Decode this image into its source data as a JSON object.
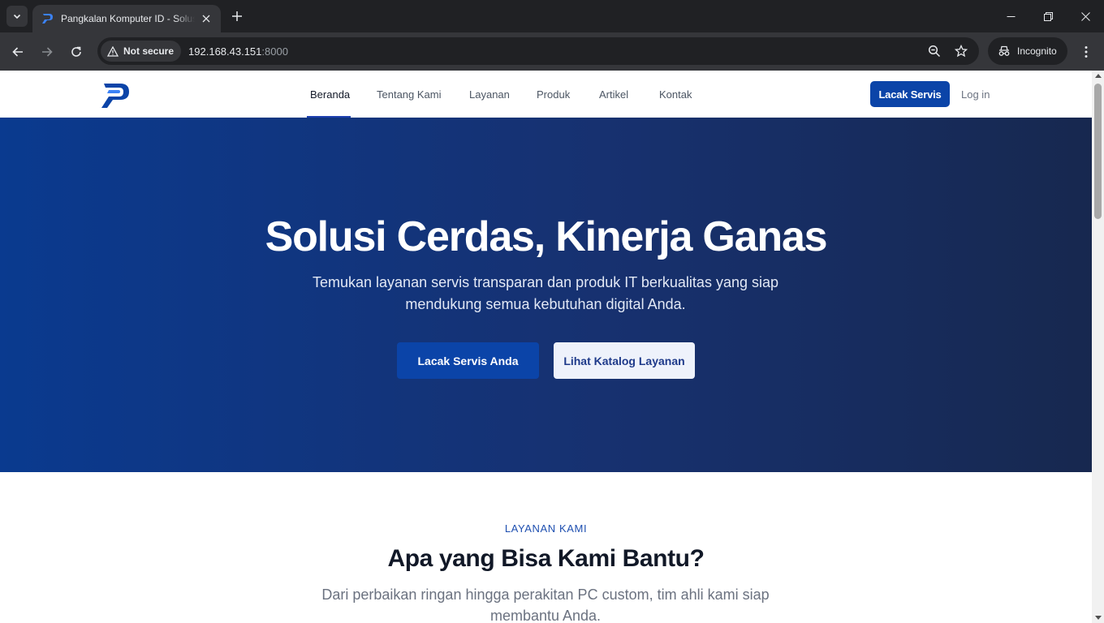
{
  "browser": {
    "tab_title": "Pangkalan Komputer ID - Solusi",
    "security_label": "Not secure",
    "url_host": "192.168.43.151",
    "url_port": ":8000",
    "incognito_label": "Incognito"
  },
  "site": {
    "nav": [
      {
        "label": "Beranda",
        "active": true
      },
      {
        "label": "Tentang Kami",
        "active": false
      },
      {
        "label": "Layanan",
        "active": false
      },
      {
        "label": "Produk",
        "active": false
      },
      {
        "label": "Artikel",
        "active": false
      },
      {
        "label": "Kontak",
        "active": false
      }
    ],
    "track_button": "Lacak Servis",
    "login_link": "Log in",
    "accent_color": "#0b44a8"
  },
  "hero": {
    "title": "Solusi Cerdas, Kinerja Ganas",
    "subtitle": "Temukan layanan servis transparan dan produk IT berkualitas yang siap mendukung semua kebutuhan digital Anda.",
    "primary_button": "Lacak Servis Anda",
    "secondary_button": "Lihat Katalog Layanan"
  },
  "services": {
    "eyebrow": "LAYANAN KAMI",
    "title": "Apa yang Bisa Kami Bantu?",
    "subtitle": "Dari perbaikan ringan hingga perakitan PC custom, tim ahli kami siap membantu Anda."
  }
}
